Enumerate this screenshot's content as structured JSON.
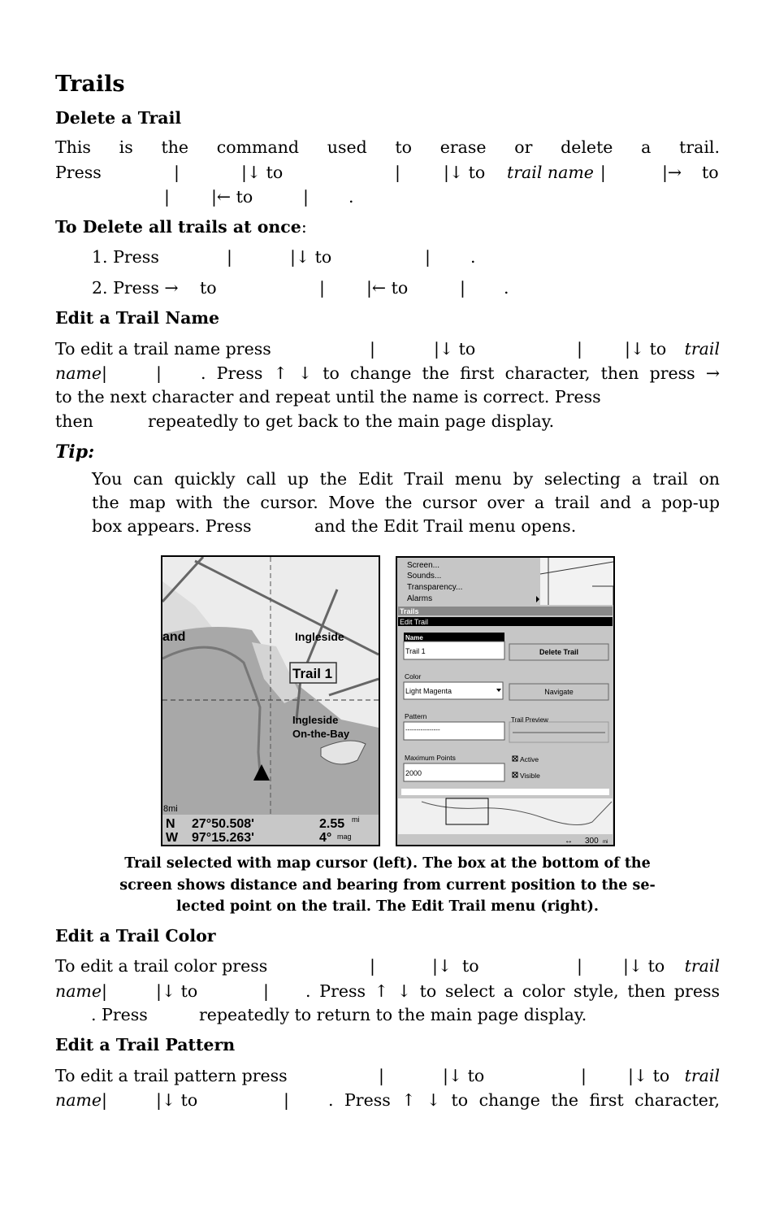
{
  "title": "Trails",
  "delete": {
    "heading": "Delete a Trail",
    "line1": "This is the command used to erase or delete a trail.",
    "press": "Press",
    "bar": "|",
    "down_to": "|↓ to",
    "down": "|↓",
    "to": "to",
    "trail_name": "trail name",
    "right": "|→",
    "left_to": "|← to",
    "dot": "."
  },
  "delete_all": {
    "heading": "To Delete all trails at once",
    "colon": ":",
    "step1": "1. Press",
    "step2": "2. Press →",
    "to": "to"
  },
  "edit_name": {
    "heading": "Edit a Trail Name",
    "l1": "To edit a trail name press",
    "trail": "trail",
    "name": "name",
    "l2": ". Press ↑ ↓ to change the first character, then press →",
    "l3": "to the next character and repeat until the name is correct. Press",
    "then": "then",
    "l4": "repeatedly to get back to the main page display."
  },
  "tip": {
    "label": "Tip:",
    "l1": "You can quickly call up the Edit Trail menu by selecting a trail on",
    "l2": "the map with the cursor. Move the cursor over a trail and a pop-up",
    "l3a": "box appears. Press",
    "l3b": "and the Edit Trail menu opens."
  },
  "left_screen": {
    "places": [
      "and",
      "Ingleside",
      "Ingleside",
      "On-the-Bay"
    ],
    "popup": "Trail 1",
    "scale": "8mi",
    "lat_dir": "N",
    "lat": "27°50.508'",
    "lon_dir": "W",
    "lon": "97°15.263'",
    "dist": "2.55",
    "dist_unit": "mi",
    "bearing": "4°",
    "bearing_unit": "mag"
  },
  "right_screen": {
    "menu": [
      "Screen...",
      "Sounds...",
      "Transparency...",
      "Alarms"
    ],
    "trails_bar": "Trails",
    "edit_bar": "Edit Trail",
    "name_label": "Name",
    "name_value": "Trail 1",
    "delete_button": "Delete Trail",
    "color_label": "Color",
    "color_value": "Light Magenta",
    "navigate_button": "Navigate",
    "pattern_label": "Pattern",
    "pattern_value": "----------------",
    "preview_label": "Trail Preview",
    "max_label": "Maximum Points",
    "max_value": "2000",
    "active_label": "Active",
    "active_checked": true,
    "visible_label": "Visible",
    "visible_checked": true,
    "scale": "300",
    "scale_unit": "mi"
  },
  "caption": [
    "Trail selected with map cursor (left). The box at the bottom of the",
    "screen shows distance and bearing from current position to the se-",
    "lected point on the trail. The Edit Trail menu (right)."
  ],
  "edit_color": {
    "heading": "Edit a Trail Color",
    "l1": "To edit a trail color press",
    "l2": ". Press ↑ ↓ to select a color style, then press",
    "l3a": ". Press",
    "l3b": "repeatedly to return to the main page display."
  },
  "edit_pattern": {
    "heading": "Edit a Trail Pattern",
    "l1": "To edit a trail pattern press",
    "l2": ". Press ↑ ↓ to change the first character,"
  }
}
